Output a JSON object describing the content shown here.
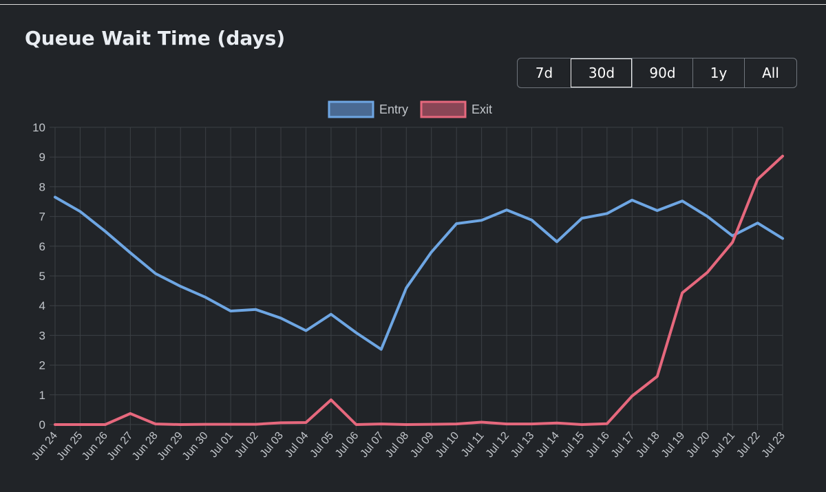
{
  "title": "Queue Wait Time (days)",
  "range_buttons": [
    {
      "label": "7d",
      "active": false
    },
    {
      "label": "30d",
      "active": true
    },
    {
      "label": "90d",
      "active": false
    },
    {
      "label": "1y",
      "active": false
    },
    {
      "label": "All",
      "active": false
    }
  ],
  "colors": {
    "entry": "#6ea6e3",
    "entry_fill": "#4a6a93",
    "exit": "#e6687d",
    "exit_fill": "#8a4656",
    "grid": "#3c4045",
    "tick": "#c2c6cb",
    "background": "#212428"
  },
  "chart_data": {
    "type": "line",
    "title": "Queue Wait Time (days)",
    "x": [
      "Jun 24",
      "Jun 25",
      "Jun 26",
      "Jun 27",
      "Jun 28",
      "Jun 29",
      "Jun 30",
      "Jul 01",
      "Jul 02",
      "Jul 03",
      "Jul 04",
      "Jul 05",
      "Jul 06",
      "Jul 07",
      "Jul 08",
      "Jul 09",
      "Jul 10",
      "Jul 11",
      "Jul 12",
      "Jul 13",
      "Jul 14",
      "Jul 15",
      "Jul 16",
      "Jul 17",
      "Jul 18",
      "Jul 19",
      "Jul 20",
      "Jul 21",
      "Jul 22",
      "Jul 23"
    ],
    "series": [
      {
        "name": "Entry",
        "values": [
          7.65,
          7.17,
          6.5,
          5.78,
          5.08,
          4.65,
          4.28,
          3.82,
          3.87,
          3.58,
          3.16,
          3.71,
          3.09,
          2.53,
          4.6,
          5.8,
          6.76,
          6.87,
          7.22,
          6.88,
          6.15,
          6.94,
          7.1,
          7.55,
          7.2,
          7.52,
          7.0,
          6.35,
          6.78,
          6.26
        ]
      },
      {
        "name": "Exit",
        "values": [
          0.0,
          0.0,
          0.0,
          0.37,
          0.02,
          0.0,
          0.01,
          0.01,
          0.01,
          0.06,
          0.07,
          0.83,
          0.0,
          0.02,
          0.0,
          0.01,
          0.02,
          0.08,
          0.02,
          0.02,
          0.05,
          0.0,
          0.03,
          0.96,
          1.62,
          4.43,
          5.12,
          6.13,
          8.25,
          9.03
        ]
      }
    ],
    "ylim": [
      0,
      10
    ],
    "y_ticks": [
      "0",
      "1",
      "2",
      "3",
      "4",
      "5",
      "6",
      "7",
      "8",
      "9",
      "10"
    ],
    "grid": true,
    "legend_position": "top-center",
    "xlabel": "",
    "ylabel": ""
  }
}
